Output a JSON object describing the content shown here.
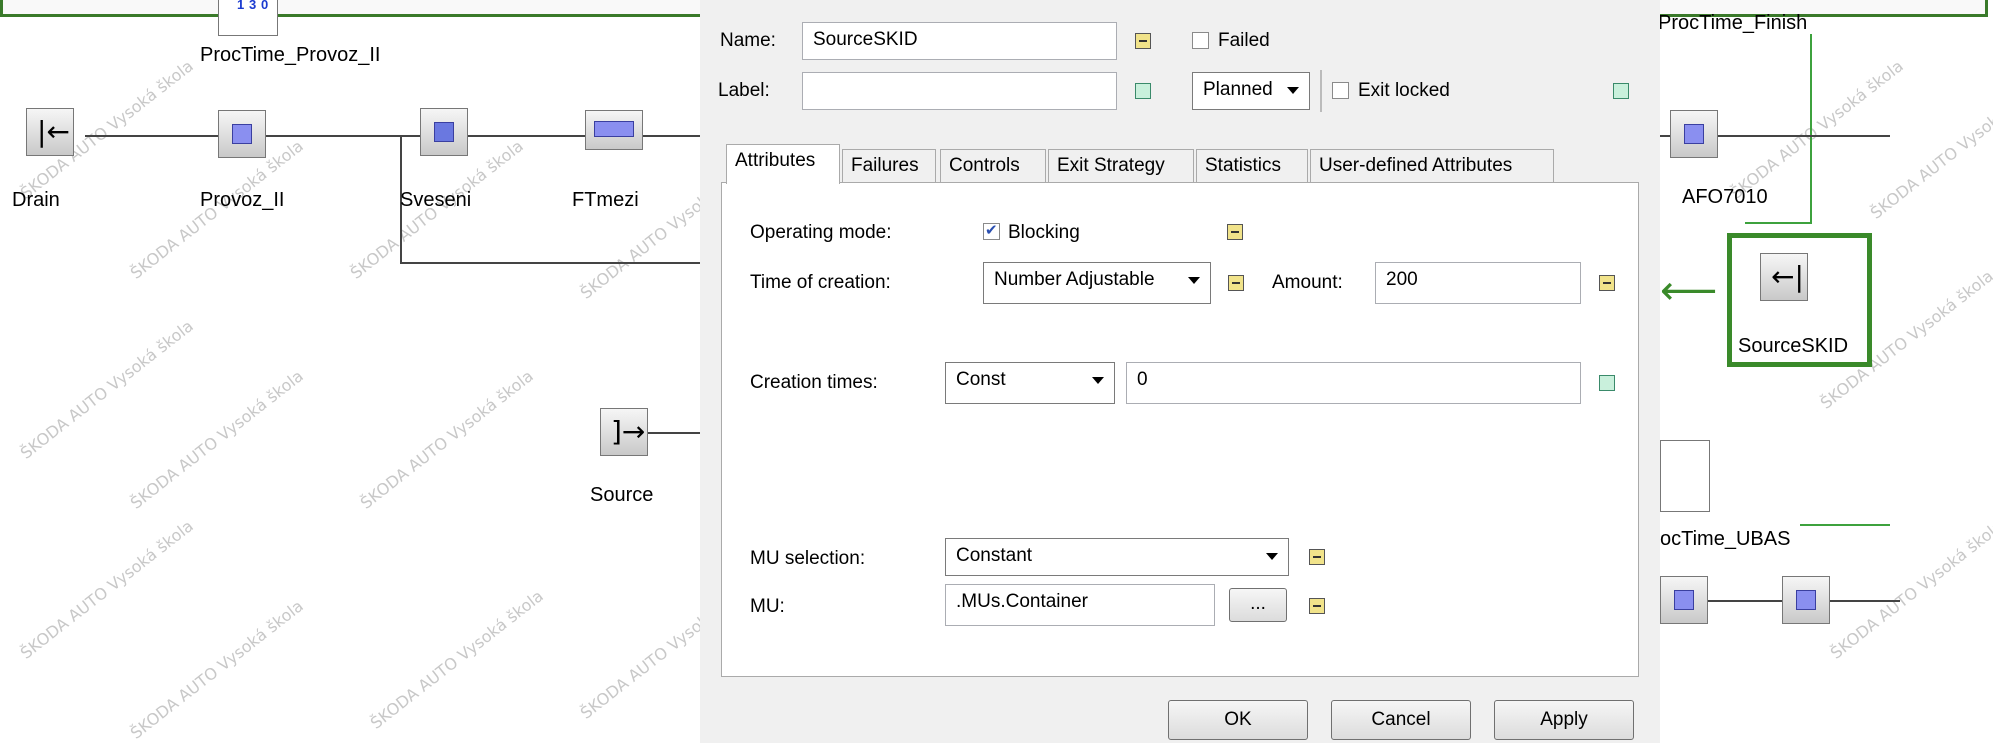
{
  "canvas": {
    "watermark_text": "ŠKODA AUTO Vysoká škola",
    "nodes": {
      "drain": "Drain",
      "provoz_ii": "Provoz_II",
      "sveseni": "Sveseni",
      "ftmezi": "FTmezi",
      "source": "Source",
      "afo7010": "AFO7010",
      "sourceskid": "SourceSKID",
      "proctime_provoz_ii": "ProcTime_Provoz_II",
      "proctime_finish": "ProcTime_Finish",
      "proctime_ubas": "ocTime_UBAS"
    },
    "table_digits": [
      "1",
      "3",
      "0"
    ]
  },
  "dialog": {
    "name_label": "Name:",
    "name_value": "SourceSKID",
    "label_label": "Label:",
    "label_value": "",
    "failed_label": "Failed",
    "failed_checked": false,
    "status_value": "Planned",
    "exit_locked_label": "Exit locked",
    "exit_locked_checked": false,
    "tabs": [
      "Attributes",
      "Failures",
      "Controls",
      "Exit Strategy",
      "Statistics",
      "User-defined Attributes"
    ],
    "active_tab": "Attributes",
    "attributes": {
      "operating_mode_label": "Operating mode:",
      "blocking_label": "Blocking",
      "blocking_checked": true,
      "time_of_creation_label": "Time of creation:",
      "time_of_creation_value": "Number Adjustable",
      "amount_label": "Amount:",
      "amount_value": "200",
      "creation_times_label": "Creation times:",
      "creation_times_value": "Const",
      "creation_times_input": "0",
      "mu_selection_label": "MU selection:",
      "mu_selection_value": "Constant",
      "mu_label": "MU:",
      "mu_value": ".MUs.Container",
      "browse_label": "..."
    },
    "buttons": {
      "ok": "OK",
      "cancel": "Cancel",
      "apply": "Apply"
    }
  },
  "colors": {
    "highlight_green": "#3a8a2a",
    "node_blue": "#8a8ff0"
  }
}
